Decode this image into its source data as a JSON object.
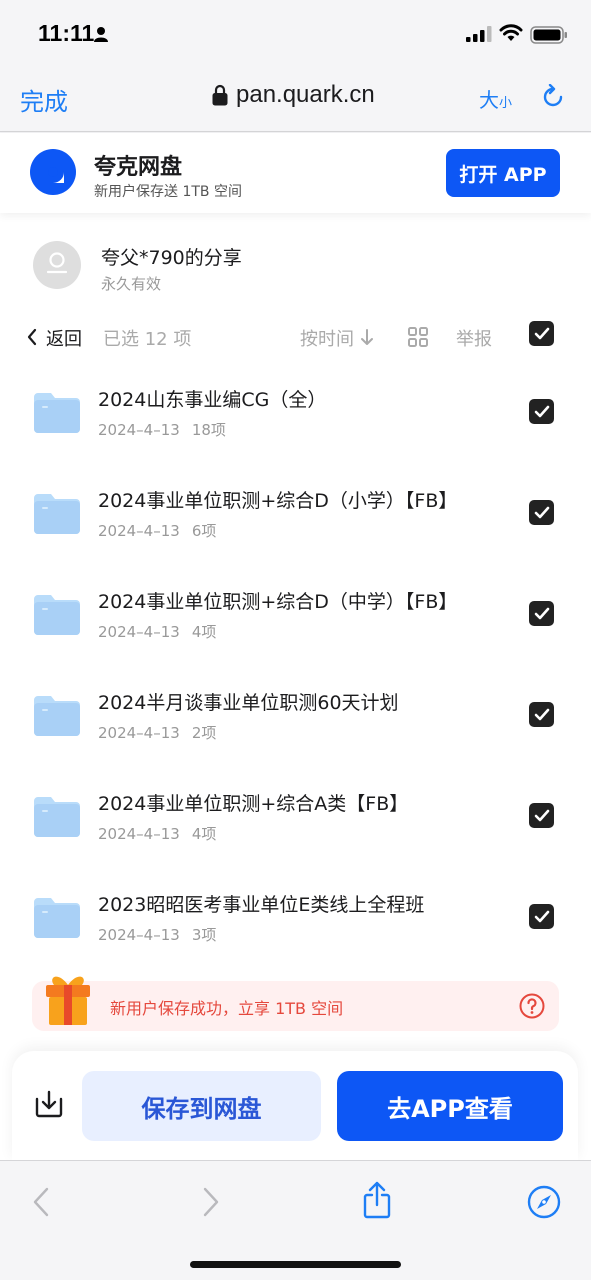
{
  "status_bar": {
    "time": "11:11"
  },
  "browser": {
    "done_label": "完成",
    "url": "pan.quark.cn",
    "text_size_big": "大",
    "text_size_small": "小"
  },
  "app_banner": {
    "name": "夸克网盘",
    "slogan": "新用户保存送 1TB 空间",
    "open_button": "打开 APP"
  },
  "share": {
    "sharer": "夸父*790的分享",
    "expire": "永久有效"
  },
  "toolbar": {
    "back_label": "返回",
    "selected": "已选 12 项",
    "sort_label": "按时间",
    "report_label": "举报"
  },
  "files": [
    {
      "name": "2024山东事业编CG（全）",
      "date": "2024–4–13",
      "count": "18项"
    },
    {
      "name": "2024事业单位职测+综合D（小学）【FB】",
      "date": "2024–4–13",
      "count": "6项"
    },
    {
      "name": "2024事业单位职测+综合D（中学）【FB】",
      "date": "2024–4–13",
      "count": "4项"
    },
    {
      "name": "2024半月谈事业单位职测60天计划",
      "date": "2024–4–13",
      "count": "2项"
    },
    {
      "name": "2024事业单位职测+综合A类【FB】",
      "date": "2024–4–13",
      "count": "4项"
    },
    {
      "name": "2023昭昭医考事业单位E类线上全程班",
      "date": "2024–4–13",
      "count": "3项"
    }
  ],
  "promo": {
    "text": "新用户保存成功，立享 1TB 空间"
  },
  "actions": {
    "save_label": "保存到网盘",
    "view_app_label": "去APP查看"
  },
  "colors": {
    "accent": "#0d57f5",
    "safari_blue": "#1e7ef5",
    "promo_red": "#e5483d",
    "folder_blue": "#a9d0f6"
  }
}
